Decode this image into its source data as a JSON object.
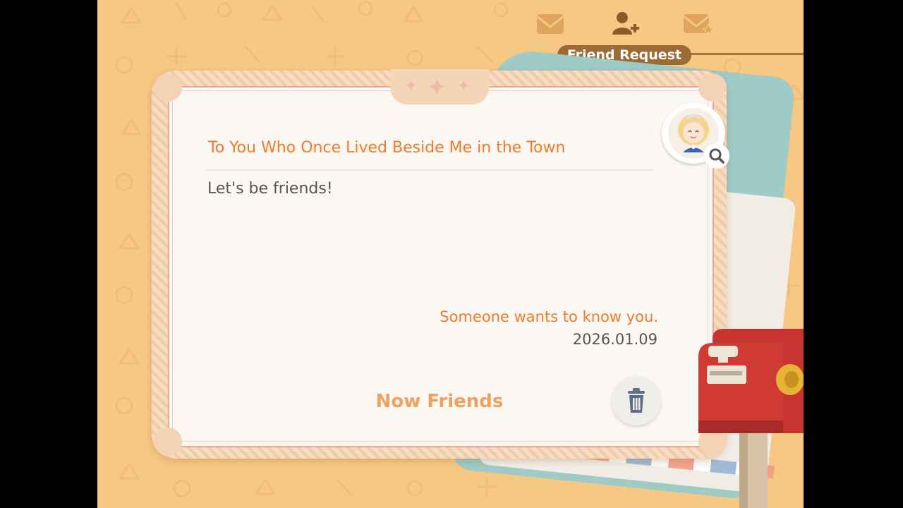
{
  "header": {
    "tabs": [
      {
        "icon": "mail-icon"
      },
      {
        "icon": "add-friend-icon"
      },
      {
        "icon": "starred-mail-icon"
      }
    ],
    "active_tab_label": "Friend Request"
  },
  "letter": {
    "title": "To You Who Once Lived Beside Me in the Town",
    "message": "Let's be friends!",
    "signature": "Someone wants to know you.",
    "date": "2026.01.09",
    "status_label": "Now Friends"
  },
  "colors": {
    "background": "#f6c884",
    "accent_orange": "#f07a2c",
    "tab_brown": "#9b6a35"
  }
}
